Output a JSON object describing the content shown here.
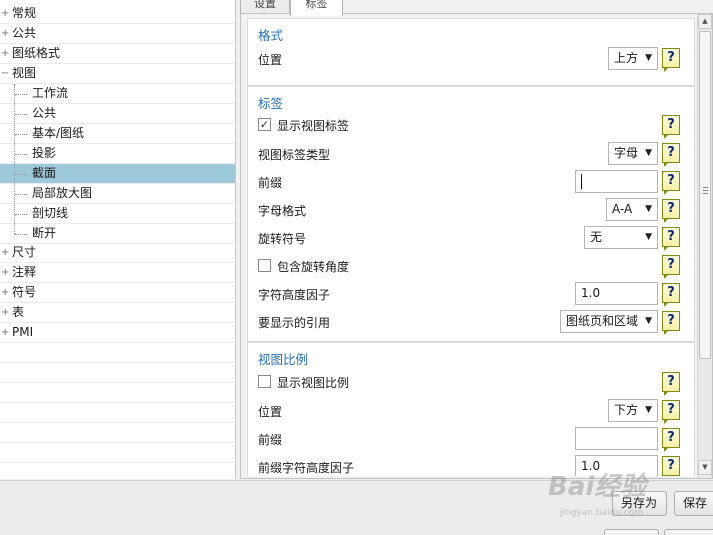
{
  "tree": {
    "top_items": [
      "常规",
      "公共",
      "图纸格式",
      "视图"
    ],
    "view_children": [
      "工作流",
      "公共",
      "基本/图纸",
      "投影",
      "截面",
      "局部放大图",
      "剖切线",
      "断开"
    ],
    "bottom_items": [
      "尺寸",
      "注释",
      "符号",
      "表",
      "PMI"
    ],
    "selected": "截面",
    "expand_symbol": "+",
    "collapse_symbol": "−"
  },
  "tabs": [
    "设置",
    "标签"
  ],
  "active_tab": "标签",
  "groups": {
    "format": {
      "title": "格式",
      "position_label": "位置",
      "position_value": "上方"
    },
    "label": {
      "title": "标签",
      "show_view_label": "显示视图标签",
      "show_view_label_checked": true,
      "label_type_label": "视图标签类型",
      "label_type_value": "字母",
      "prefix_label": "前缀",
      "prefix_value": "",
      "letter_format_label": "字母格式",
      "letter_format_value": "A-A",
      "rotation_symbol_label": "旋转符号",
      "rotation_symbol_value": "无",
      "include_rotation_angle": "包含旋转角度",
      "include_rotation_angle_checked": false,
      "char_height_factor_label": "字符高度因子",
      "char_height_factor_value": "1.0",
      "references_label": "要显示的引用",
      "references_value": "图纸页和区域"
    },
    "scale": {
      "title": "视图比例",
      "show_view_scale": "显示视图比例",
      "show_view_scale_checked": false,
      "position_label": "位置",
      "position_value": "下方",
      "prefix_label": "前缀",
      "prefix_value": "",
      "prefix_char_height_label": "前缀字符高度因子",
      "prefix_char_height_value": "1.0"
    }
  },
  "help_glyph": "?",
  "dropdown_arrow": "▼",
  "checkmark": "✓",
  "buttons": {
    "save_as": "另存为",
    "save": "保存"
  },
  "watermark": {
    "text": "Bai经验",
    "sub": "jingyan.baidu.com"
  },
  "colors": {
    "selection": "#9ec9da",
    "group_title": "#2a6fb5",
    "help_fill": "#f4f0a6"
  }
}
